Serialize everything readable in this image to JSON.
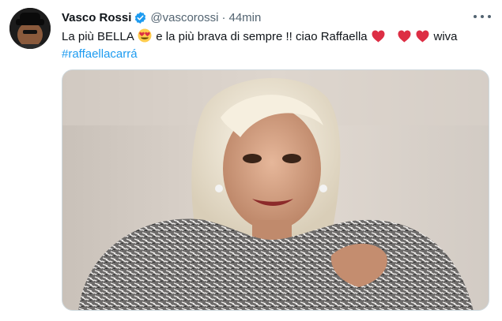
{
  "tweet": {
    "display_name": "Vasco Rossi",
    "handle": "@vascorossi",
    "separator": "·",
    "time": "44min",
    "text_part1": "La più BELLA",
    "text_part2": "e la più brava di sempre !! ciao Raffaella",
    "text_part3": "wiva",
    "hashtag": "#raffaellacarrá",
    "icons": {
      "verified": "verified-badge-icon",
      "more": "more-options-icon",
      "heart_eyes": "heart-eyes-emoji",
      "heart": "red-heart-emoji"
    }
  },
  "colors": {
    "accent": "#1d9bf0",
    "heart": "#e0245e",
    "muted": "#536471"
  }
}
